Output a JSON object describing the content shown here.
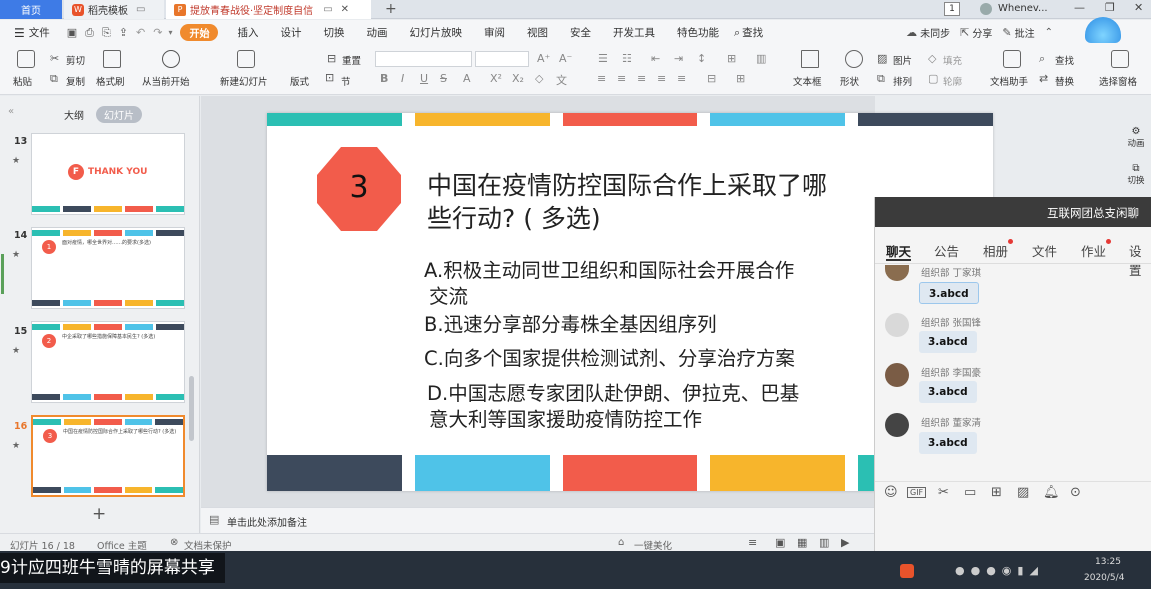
{
  "tabs": [
    {
      "label": "首页"
    },
    {
      "label": "稻壳模板"
    },
    {
      "label": "提放青春战役·坚定制度自信"
    }
  ],
  "window": {
    "page_badge": "1",
    "user": "Whenev..."
  },
  "menu": [
    "文件",
    "开始",
    "插入",
    "设计",
    "切换",
    "动画",
    "幻灯片放映",
    "审阅",
    "视图",
    "安全",
    "开发工具",
    "特色功能",
    "查找"
  ],
  "menu_right": {
    "sync": "未同步",
    "share": "分享",
    "comment": "批注"
  },
  "ribbon": {
    "paste": "粘贴",
    "cut": "剪切",
    "copy": "复制",
    "format_painter": "格式刷",
    "from_current": "从当前开始",
    "new_slide": "新建幻灯片",
    "layout": "版式",
    "section": "节",
    "reset": "重置",
    "textbox": "文本框",
    "shape": "形状",
    "picture": "图片",
    "arrange": "排列",
    "fill": "填充",
    "outline": "轮廓",
    "doc_helper": "文档助手",
    "find": "查找",
    "replace": "替换",
    "select_pane": "选择窗格"
  },
  "leftpane": {
    "outline_tab": "大纲",
    "slides_tab": "幻灯片",
    "thumbs": [
      {
        "num": "13",
        "title": "THANK YOU"
      },
      {
        "num": "14",
        "title": "面对疫情，哪全世界对……的要求(多选)"
      },
      {
        "num": "15",
        "title": "中企采取了哪些措施保障基本民生? (多选)"
      },
      {
        "num": "16",
        "title": "中国在疫情防控国际合作上采取了哪些行动? (多选)"
      }
    ],
    "add": "+"
  },
  "slide": {
    "number": "3",
    "question_line1": "中国在疫情防控国际合作上采取了哪",
    "question_line2": "些行动? ( 多选)",
    "option_a_line1": "A.积极主动同世卫组织和国际社会开展合作",
    "option_a_line2": "交流",
    "option_b": "B.迅速分享部分毒株全基因组序列",
    "option_c": "C.向多个国家提供检测试剂、分享治疗方案",
    "option_d_line1": "D.中国志愿专家团队赴伊朗、伊拉克、巴基",
    "option_d_line2": "意大利等国家援助疫情防控工作",
    "colors": [
      "#2bbfb3",
      "#f7b52c",
      "#f25c4b",
      "#4fc3e8",
      "#3d4a5c"
    ]
  },
  "notes": {
    "placeholder": "单击此处添加备注"
  },
  "status": {
    "slide_count": "幻灯片 16 / 18",
    "theme": "Office 主题",
    "protection": "文档未保护",
    "beautify": "一键美化"
  },
  "chat": {
    "title": "互联网团总支闲聊",
    "tabs": [
      "聊天",
      "公告",
      "相册",
      "文件",
      "作业",
      "设置"
    ],
    "messages": [
      {
        "user": "组织部 丁家琪",
        "text": "3.abcd"
      },
      {
        "user": "组织部 张国锋",
        "text": "3.abcd"
      },
      {
        "user": "组织部 李国豪",
        "text": "3.abcd"
      },
      {
        "user": "组织部 董家清",
        "text": "3.abcd"
      }
    ]
  },
  "overlay": {
    "caption": "9计应四班牛雪晴的屏幕共享"
  },
  "taskbar": {
    "time": "13:25",
    "date": "2020/5/4"
  }
}
